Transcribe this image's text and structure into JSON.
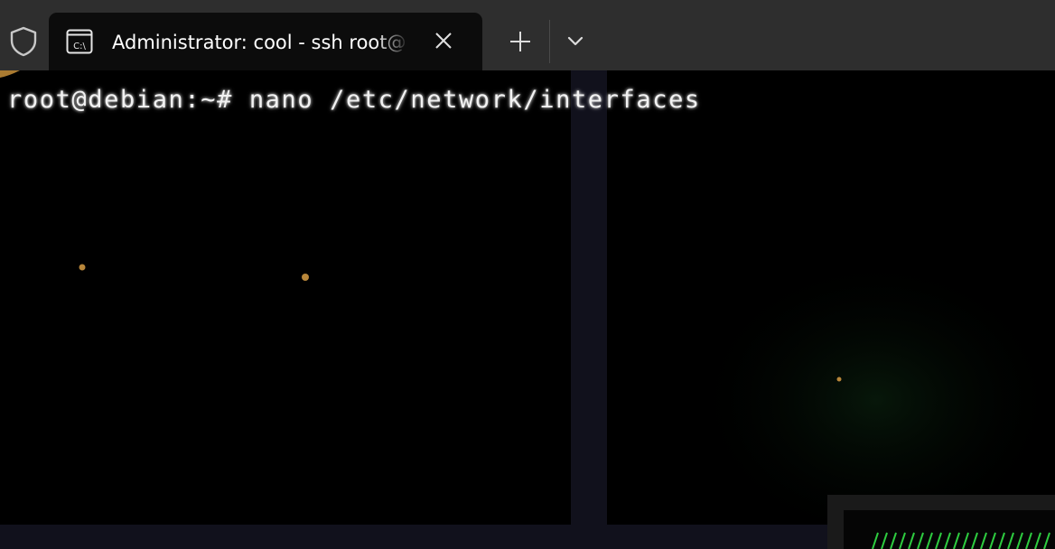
{
  "window": {
    "icons": {
      "shield": "shield-icon",
      "tab": "command-prompt-icon",
      "close": "close-icon",
      "new_tab": "plus-icon",
      "dropdown": "chevron-down-icon"
    },
    "tab": {
      "title": "Administrator: cool - ssh  root@",
      "icon_text": "C:\\"
    }
  },
  "terminal": {
    "lines": [
      "root@debian:~# nano /etc/network/interfaces"
    ],
    "colors": {
      "background": "#000000",
      "foreground": "#f2f2f2",
      "tabbar": "#2e2e2e",
      "active_tab": "#0c0c0c",
      "accent_green": "#2ecc40"
    }
  }
}
